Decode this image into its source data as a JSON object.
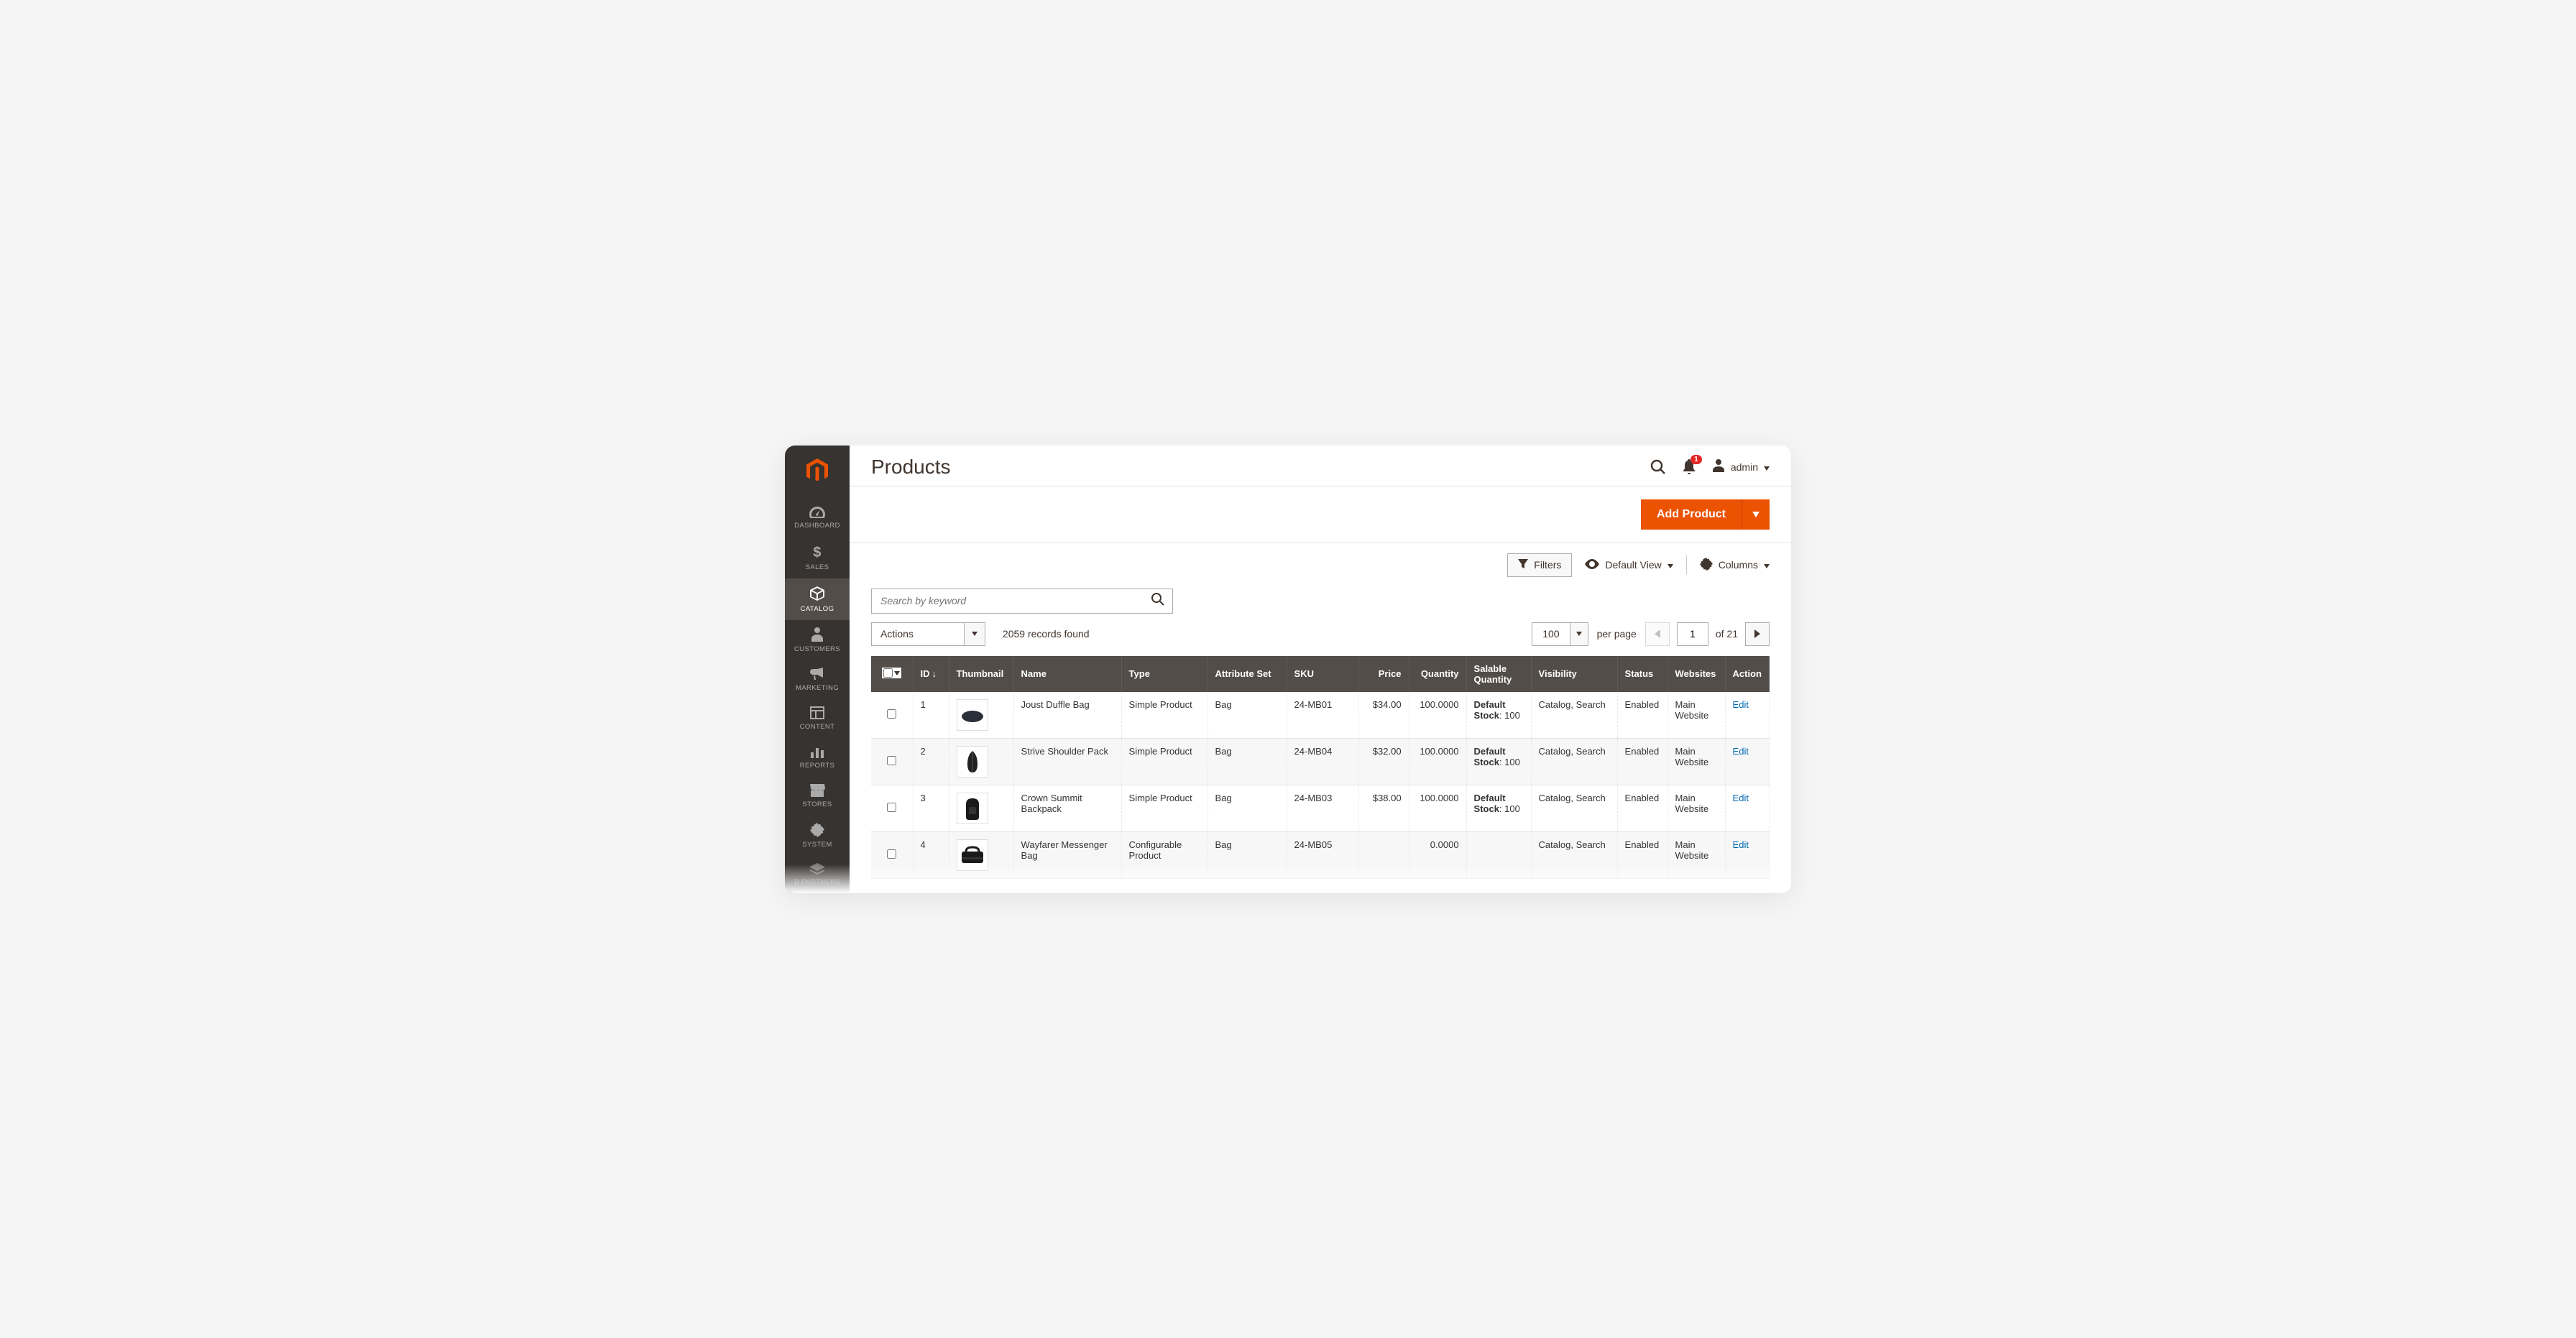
{
  "header": {
    "title": "Products",
    "notifications": "1",
    "user_label": "admin"
  },
  "sidebar": {
    "items": [
      {
        "label": "DASHBOARD"
      },
      {
        "label": "SALES"
      },
      {
        "label": "CATALOG"
      },
      {
        "label": "CUSTOMERS"
      },
      {
        "label": "MARKETING"
      },
      {
        "label": "CONTENT"
      },
      {
        "label": "REPORTS"
      },
      {
        "label": "STORES"
      },
      {
        "label": "SYSTEM"
      },
      {
        "label": "D PARTNERS"
      }
    ]
  },
  "toolbar": {
    "add_product": "Add Product",
    "filters": "Filters",
    "default_view": "Default View",
    "columns": "Columns"
  },
  "search": {
    "placeholder": "Search by keyword"
  },
  "grid": {
    "actions_label": "Actions",
    "records_found": "2059 records found",
    "page_size": "100",
    "per_page_label": "per page",
    "current_page": "1",
    "of_pages": "of 21"
  },
  "columns": {
    "id": "ID",
    "thumbnail": "Thumbnail",
    "name": "Name",
    "type": "Type",
    "attribute_set": "Attribute Set",
    "sku": "SKU",
    "price": "Price",
    "quantity": "Quantity",
    "salable_quantity": "Salable Quantity",
    "visibility": "Visibility",
    "status": "Status",
    "websites": "Websites",
    "action": "Action"
  },
  "rows": [
    {
      "id": "1",
      "name": "Joust Duffle Bag",
      "type": "Simple Product",
      "attr": "Bag",
      "sku": "24-MB01",
      "price": "$34.00",
      "qty": "100.0000",
      "salable_label": "Default Stock",
      "salable_val": ": 100",
      "vis": "Catalog, Search",
      "status": "Enabled",
      "web": "Main Website",
      "action": "Edit"
    },
    {
      "id": "2",
      "name": "Strive Shoulder Pack",
      "type": "Simple Product",
      "attr": "Bag",
      "sku": "24-MB04",
      "price": "$32.00",
      "qty": "100.0000",
      "salable_label": "Default Stock",
      "salable_val": ": 100",
      "vis": "Catalog, Search",
      "status": "Enabled",
      "web": "Main Website",
      "action": "Edit"
    },
    {
      "id": "3",
      "name": "Crown Summit Backpack",
      "type": "Simple Product",
      "attr": "Bag",
      "sku": "24-MB03",
      "price": "$38.00",
      "qty": "100.0000",
      "salable_label": "Default Stock",
      "salable_val": ": 100",
      "vis": "Catalog, Search",
      "status": "Enabled",
      "web": "Main Website",
      "action": "Edit"
    },
    {
      "id": "4",
      "name": "Wayfarer Messenger Bag",
      "type": "Configurable Product",
      "attr": "Bag",
      "sku": "24-MB05",
      "price": "",
      "qty": "0.0000",
      "salable_label": "",
      "salable_val": "",
      "vis": "Catalog, Search",
      "status": "Enabled",
      "web": "Main Website",
      "action": "Edit"
    }
  ]
}
